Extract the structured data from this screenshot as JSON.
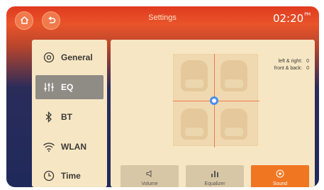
{
  "header": {
    "title": "Settings",
    "time": "02:20",
    "time_suffix": "PM",
    "home_icon": "home-icon",
    "back_icon": "back-icon"
  },
  "sidebar": {
    "items": [
      {
        "label": "General",
        "icon": "gear-icon",
        "active": false
      },
      {
        "label": "EQ",
        "icon": "equalizer-icon",
        "active": true
      },
      {
        "label": "BT",
        "icon": "bluetooth-icon",
        "active": false
      },
      {
        "label": "WLAN",
        "icon": "wifi-icon",
        "active": false
      },
      {
        "label": "Time",
        "icon": "clock-icon",
        "active": false
      }
    ]
  },
  "balance": {
    "left_right_label": "left & right:",
    "left_right_value": "0",
    "front_back_label": "front & back:",
    "front_back_value": "0"
  },
  "tabs": [
    {
      "label": "Volume",
      "icon": "speaker-icon",
      "active": false
    },
    {
      "label": "Equalizer",
      "icon": "equalizer-bars-icon",
      "active": false
    },
    {
      "label": "Sound",
      "icon": "sound-field-icon",
      "active": true
    }
  ],
  "colors": {
    "accent": "#f07622",
    "panel": "#f6e6c3",
    "active_sidebar": "#8f8b85",
    "knob": "#4a8df0"
  }
}
